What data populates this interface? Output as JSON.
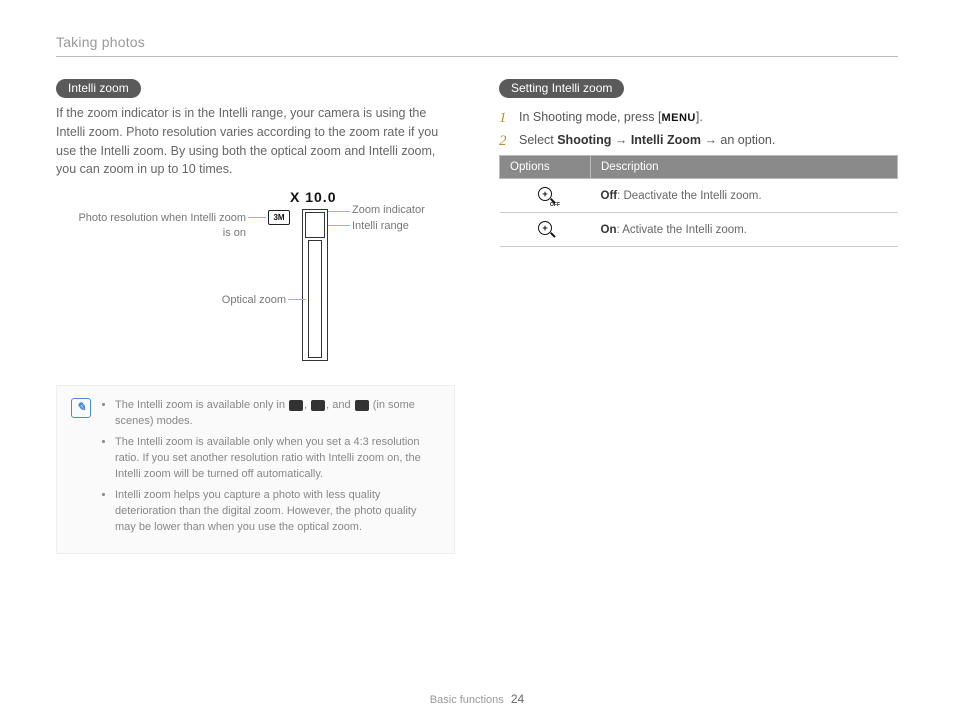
{
  "header": {
    "title": "Taking photos"
  },
  "left": {
    "pill": "Intelli zoom",
    "paragraph": "If the zoom indicator is in the Intelli range, your camera is using the Intelli zoom. Photo resolution varies according to the zoom rate if you use the Intelli zoom. By using both the optical zoom and Intelli zoom, you can zoom in up to 10 times.",
    "diagram": {
      "zoom_value": "X 10.0",
      "res_badge": "3M",
      "callout_resolution": "Photo resolution when Intelli zoom is on",
      "callout_zoom_indicator": "Zoom indicator",
      "callout_intelli_range": "Intelli range",
      "callout_optical_zoom": "Optical zoom"
    },
    "notes": {
      "n1_a": "The Intelli zoom is available only in ",
      "n1_b": ", ",
      "n1_c": ", and ",
      "n1_d": " (in some scenes) modes.",
      "n2": "The Intelli zoom is available only when you set a 4:3 resolution ratio. If you set another resolution ratio with Intelli zoom on, the Intelli zoom will be turned off automatically.",
      "n3": "Intelli zoom helps you capture a photo with less quality deterioration than the digital zoom. However, the photo quality may be lower than when you use the optical zoom."
    }
  },
  "right": {
    "pill": "Setting Intelli zoom",
    "step1_a": "In Shooting mode, press [",
    "step1_menu": "MENU",
    "step1_b": "].",
    "step2_a": "Select ",
    "step2_shooting": "Shooting",
    "step2_arrow1": " → ",
    "step2_intelli": "Intelli Zoom",
    "step2_arrow2": " → ",
    "step2_b": "an option.",
    "table": {
      "h1": "Options",
      "h2": "Description",
      "row1_bold": "Off",
      "row1_rest": ": Deactivate the Intelli zoom.",
      "row2_bold": "On",
      "row2_rest": ": Activate the Intelli zoom."
    }
  },
  "footer": {
    "section": "Basic functions",
    "page": "24"
  }
}
